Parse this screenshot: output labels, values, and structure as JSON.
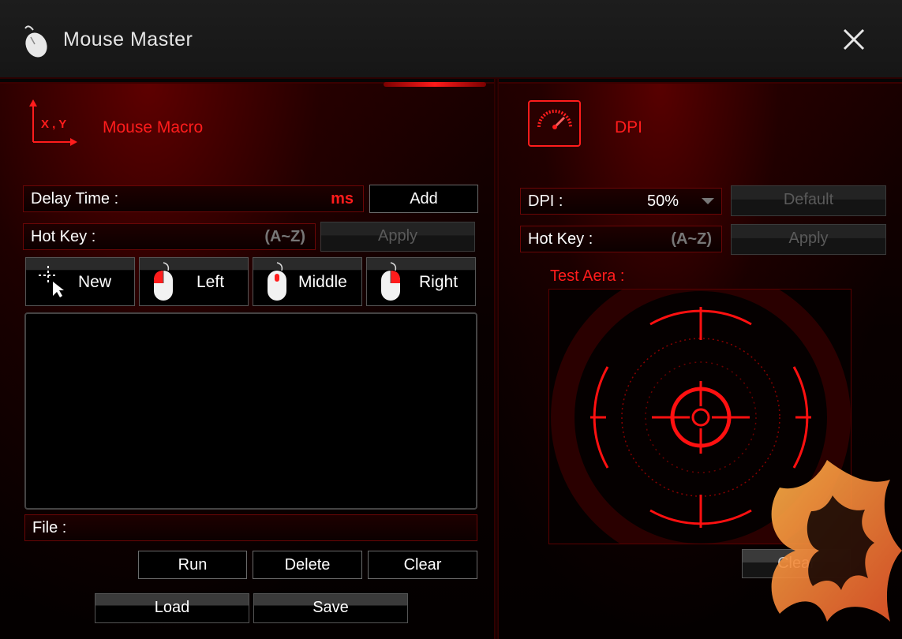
{
  "window": {
    "title": "Mouse Master",
    "close_icon": "close-icon"
  },
  "macro": {
    "section_title": "Mouse Macro",
    "section_icon": "xy-axis-icon",
    "axis_label": "X , Y",
    "delay_label": "Delay Time :",
    "delay_unit": "ms",
    "add_label": "Add",
    "hotkey_label": "Hot Key :",
    "hotkey_hint": "(A~Z)",
    "apply_label": "Apply",
    "buttons": {
      "new": "New",
      "left": "Left",
      "middle": "Middle",
      "right": "Right"
    },
    "file_label": "File :",
    "run_label": "Run",
    "delete_label": "Delete",
    "clear_label": "Clear",
    "load_label": "Load",
    "save_label": "Save"
  },
  "dpi": {
    "section_title": "DPI",
    "section_icon": "speedometer-icon",
    "dpi_label": "DPI :",
    "dpi_value": "50%",
    "default_label": "Default",
    "hotkey_label": "Hot Key :",
    "hotkey_hint": "(A~Z)",
    "apply_label": "Apply",
    "test_area_label": "Test Aera :",
    "clear_label": "Clear"
  },
  "colors": {
    "accent": "#ff1c1c",
    "panel": "#0c0000",
    "border": "#6a0606"
  }
}
